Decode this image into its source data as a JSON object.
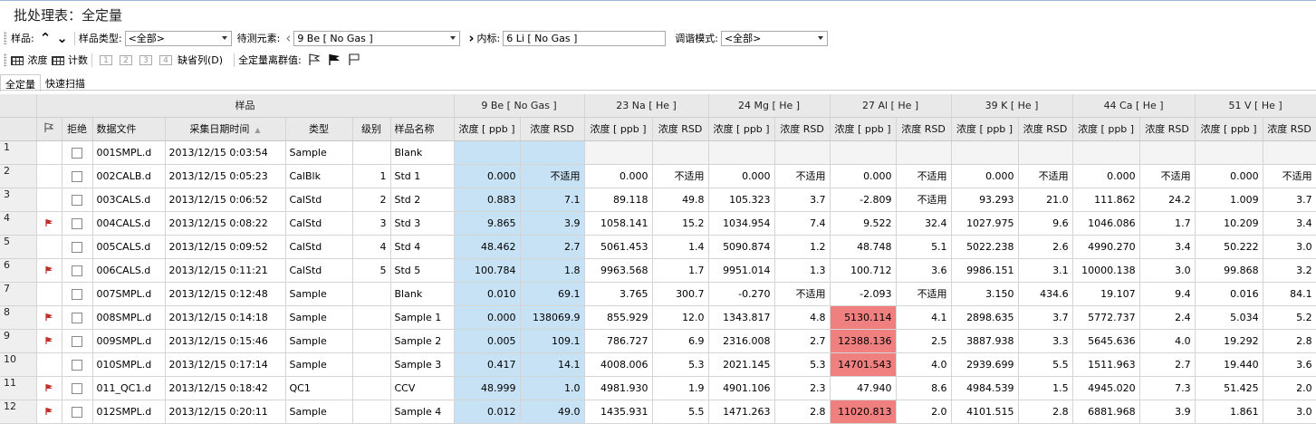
{
  "title": "批处理表：全定量",
  "toolbar1": {
    "sample_label": "样品:",
    "sample_type_label": "样品类型:",
    "sample_type_value": "<全部>",
    "element_label": "待测元素:",
    "element_value": "9  Be  [ No Gas ]",
    "istd_label": "内标:",
    "istd_value": "6  Li  [ No Gas ]",
    "tune_label": "调谐模式:",
    "tune_value": "<全部>"
  },
  "toolbar2": {
    "conc_label": "浓度",
    "count_label": "计数",
    "btn1": "1",
    "btn2": "2",
    "btn3": "3",
    "btn4": "4",
    "default_cols": "缺省列(D)",
    "outlier_label": "全定量离群值:"
  },
  "tabs": [
    "全定量",
    "快速扫描"
  ],
  "group_headers": {
    "sample": "样品",
    "elements": [
      "9  Be  [ No Gas ]",
      "23  Na  [ He ]",
      "24  Mg  [ He ]",
      "27  Al  [ He ]",
      "39  K  [ He ]",
      "44  Ca  [ He ]",
      "51  V  [ He ]"
    ]
  },
  "column_headers": {
    "reject": "拒绝",
    "datafile": "数据文件",
    "datetime": "采集日期时间",
    "type": "类型",
    "level": "级别",
    "name": "样品名称",
    "conc": "浓度 [ ppb ]",
    "rsd": "浓度 RSD"
  },
  "rows": [
    {
      "n": "1",
      "flag": false,
      "file": "001SMPL.d",
      "dt": "2013/12/15 0:03:54",
      "type": "Sample",
      "level": "",
      "name": "Blank",
      "v": [
        "",
        "",
        "",
        "",
        "",
        "",
        "",
        "",
        "",
        "",
        "",
        "",
        "",
        ""
      ],
      "hl": []
    },
    {
      "n": "2",
      "flag": false,
      "file": "002CALB.d",
      "dt": "2013/12/15 0:05:23",
      "type": "CalBlk",
      "level": "1",
      "name": "Std 1",
      "v": [
        "0.000",
        "不适用",
        "0.000",
        "不适用",
        "0.000",
        "不适用",
        "0.000",
        "不适用",
        "0.000",
        "不适用",
        "0.000",
        "不适用",
        "0.000",
        "不适用"
      ],
      "hl": []
    },
    {
      "n": "3",
      "flag": false,
      "file": "003CALS.d",
      "dt": "2013/12/15 0:06:52",
      "type": "CalStd",
      "level": "2",
      "name": "Std 2",
      "v": [
        "0.883",
        "7.1",
        "89.118",
        "49.8",
        "105.323",
        "3.7",
        "-2.809",
        "不适用",
        "93.293",
        "21.0",
        "111.862",
        "24.2",
        "1.009",
        "3.7"
      ],
      "hl": []
    },
    {
      "n": "4",
      "flag": true,
      "file": "004CALS.d",
      "dt": "2013/12/15 0:08:22",
      "type": "CalStd",
      "level": "3",
      "name": "Std 3",
      "v": [
        "9.865",
        "3.9",
        "1058.141",
        "15.2",
        "1034.954",
        "7.4",
        "9.522",
        "32.4",
        "1027.975",
        "9.6",
        "1046.086",
        "1.7",
        "10.209",
        "3.4"
      ],
      "hl": []
    },
    {
      "n": "5",
      "flag": false,
      "file": "005CALS.d",
      "dt": "2013/12/15 0:09:52",
      "type": "CalStd",
      "level": "4",
      "name": "Std 4",
      "v": [
        "48.462",
        "2.7",
        "5061.453",
        "1.4",
        "5090.874",
        "1.2",
        "48.748",
        "5.1",
        "5022.238",
        "2.6",
        "4990.270",
        "3.4",
        "50.222",
        "3.0"
      ],
      "hl": []
    },
    {
      "n": "6",
      "flag": true,
      "file": "006CALS.d",
      "dt": "2013/12/15 0:11:21",
      "type": "CalStd",
      "level": "5",
      "name": "Std 5",
      "v": [
        "100.784",
        "1.8",
        "9963.568",
        "1.7",
        "9951.014",
        "1.3",
        "100.712",
        "3.6",
        "9986.151",
        "3.1",
        "10000.138",
        "3.0",
        "99.868",
        "3.2"
      ],
      "hl": []
    },
    {
      "n": "7",
      "flag": false,
      "file": "007SMPL.d",
      "dt": "2013/12/15 0:12:48",
      "type": "Sample",
      "level": "",
      "name": "Blank",
      "v": [
        "0.010",
        "69.1",
        "3.765",
        "300.7",
        "-0.270",
        "不适用",
        "-2.093",
        "不适用",
        "3.150",
        "434.6",
        "19.107",
        "9.4",
        "0.016",
        "84.1"
      ],
      "hl": []
    },
    {
      "n": "8",
      "flag": true,
      "file": "008SMPL.d",
      "dt": "2013/12/15 0:14:18",
      "type": "Sample",
      "level": "",
      "name": "Sample 1",
      "v": [
        "0.000",
        "138069.9",
        "855.929",
        "12.0",
        "1343.817",
        "4.8",
        "5130.114",
        "4.1",
        "2898.635",
        "3.7",
        "5772.737",
        "2.4",
        "5.034",
        "5.2"
      ],
      "hl": [
        6
      ]
    },
    {
      "n": "9",
      "flag": true,
      "file": "009SMPL.d",
      "dt": "2013/12/15 0:15:46",
      "type": "Sample",
      "level": "",
      "name": "Sample 2",
      "v": [
        "0.005",
        "109.1",
        "786.727",
        "6.9",
        "2316.008",
        "2.7",
        "12388.136",
        "2.5",
        "3887.938",
        "3.3",
        "5645.636",
        "4.0",
        "19.292",
        "2.8"
      ],
      "hl": [
        6
      ]
    },
    {
      "n": "10",
      "flag": false,
      "file": "010SMPL.d",
      "dt": "2013/12/15 0:17:14",
      "type": "Sample",
      "level": "",
      "name": "Sample 3",
      "v": [
        "0.417",
        "14.1",
        "4008.006",
        "5.3",
        "2021.145",
        "5.3",
        "14701.543",
        "4.0",
        "2939.699",
        "5.5",
        "1511.963",
        "2.7",
        "19.440",
        "3.6"
      ],
      "hl": [
        6
      ]
    },
    {
      "n": "11",
      "flag": true,
      "file": "011_QC1.d",
      "dt": "2013/12/15 0:18:42",
      "type": "QC1",
      "level": "",
      "name": "CCV",
      "v": [
        "48.999",
        "1.0",
        "4981.930",
        "1.9",
        "4901.106",
        "2.3",
        "47.940",
        "8.6",
        "4984.539",
        "1.5",
        "4945.020",
        "7.3",
        "51.425",
        "2.0"
      ],
      "hl": []
    },
    {
      "n": "12",
      "flag": true,
      "file": "012SMPL.d",
      "dt": "2013/12/15 0:20:11",
      "type": "Sample",
      "level": "",
      "name": "Sample 4",
      "v": [
        "0.012",
        "49.0",
        "1435.931",
        "5.5",
        "1471.263",
        "2.8",
        "11020.813",
        "2.0",
        "4101.515",
        "2.8",
        "6881.968",
        "3.9",
        "1.861",
        "3.0"
      ],
      "hl": [
        6
      ]
    }
  ],
  "colors": {
    "selected": "#c8e2f5",
    "outlier": "#f08080",
    "flag": "#c0302a"
  }
}
